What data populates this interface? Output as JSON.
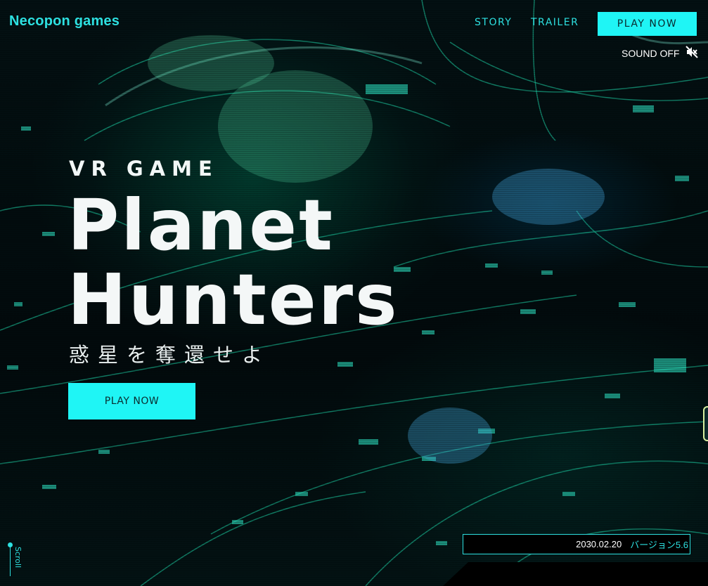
{
  "header": {
    "logo": "Necopon games",
    "nav": {
      "story": "STORY",
      "trailer": "TRAILER"
    },
    "play_now": "PLAY NOW",
    "sound_label": "SOUND OFF",
    "sound_icon": "speaker-muted-icon"
  },
  "hero": {
    "subtitle": "VR GAME",
    "title_line1": "Planet",
    "title_line2": "Hunters",
    "tagline_jp": "惑星を奪還せよ",
    "cta": "PLAY NOW"
  },
  "scroll": {
    "label": "Scroll"
  },
  "news": {
    "date": "2030.02.20",
    "text": "バージョン5.6"
  },
  "colors": {
    "accent": "#1ff5f5",
    "accent_text": "#2de0e0",
    "background": "#02090b",
    "button_text": "#0a2d30"
  }
}
